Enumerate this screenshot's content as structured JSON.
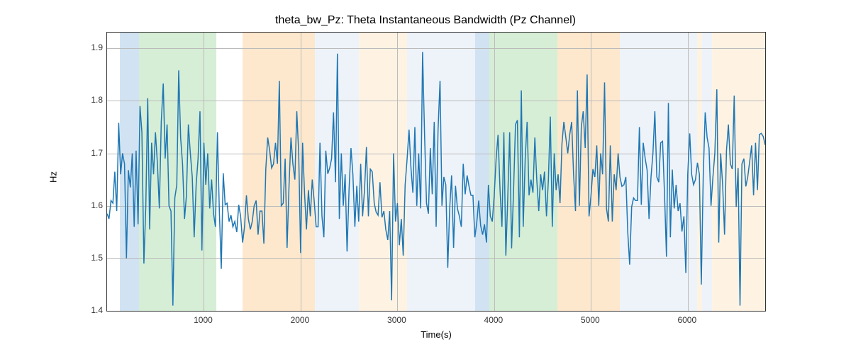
{
  "chart_data": {
    "type": "line",
    "title": "theta_bw_Pz: Theta Instantaneous Bandwidth (Pz Channel)",
    "xlabel": "Time(s)",
    "ylabel": "Hz",
    "xlim": [
      0,
      6800
    ],
    "ylim": [
      1.4,
      1.93
    ],
    "xticks": [
      1000,
      2000,
      3000,
      4000,
      5000,
      6000
    ],
    "yticks": [
      1.4,
      1.5,
      1.6,
      1.7,
      1.8,
      1.9
    ],
    "span_colors": {
      "blue": "#6fa8d6",
      "green": "#7fc97f",
      "orange": "#fdb863",
      "lightblue": "#c6d9ec",
      "lightorange": "#fdd9a8"
    },
    "spans": [
      {
        "start": 130,
        "end": 330,
        "color": "blue"
      },
      {
        "start": 330,
        "end": 1130,
        "color": "green"
      },
      {
        "start": 1400,
        "end": 2150,
        "color": "orange"
      },
      {
        "start": 2150,
        "end": 2600,
        "color": "lightblue"
      },
      {
        "start": 2600,
        "end": 3100,
        "color": "lightorange"
      },
      {
        "start": 3100,
        "end": 3800,
        "color": "lightblue"
      },
      {
        "start": 3800,
        "end": 3950,
        "color": "blue"
      },
      {
        "start": 3950,
        "end": 4650,
        "color": "green"
      },
      {
        "start": 4650,
        "end": 5300,
        "color": "orange"
      },
      {
        "start": 5300,
        "end": 6100,
        "color": "lightblue"
      },
      {
        "start": 6100,
        "end": 6150,
        "color": "lightorange"
      },
      {
        "start": 6150,
        "end": 6250,
        "color": "lightblue"
      },
      {
        "start": 6250,
        "end": 6800,
        "color": "lightorange"
      }
    ],
    "series": [
      {
        "name": "theta_bw_Pz",
        "x": [
          0,
          20,
          40,
          60,
          80,
          100,
          120,
          140,
          160,
          180,
          200,
          220,
          240,
          260,
          280,
          300,
          320,
          340,
          360,
          380,
          400,
          420,
          440,
          460,
          480,
          500,
          520,
          540,
          560,
          580,
          600,
          620,
          640,
          660,
          680,
          700,
          720,
          740,
          760,
          780,
          800,
          820,
          840,
          860,
          880,
          900,
          920,
          940,
          960,
          980,
          1000,
          1020,
          1040,
          1060,
          1080,
          1100,
          1120,
          1140,
          1160,
          1180,
          1200,
          1220,
          1240,
          1260,
          1280,
          1300,
          1320,
          1340,
          1360,
          1380,
          1400,
          1420,
          1440,
          1460,
          1480,
          1500,
          1520,
          1540,
          1560,
          1580,
          1600,
          1620,
          1640,
          1660,
          1680,
          1700,
          1720,
          1740,
          1760,
          1780,
          1800,
          1820,
          1840,
          1860,
          1880,
          1900,
          1920,
          1940,
          1960,
          1980,
          2000,
          2020,
          2040,
          2060,
          2080,
          2100,
          2120,
          2140,
          2160,
          2180,
          2200,
          2220,
          2240,
          2260,
          2280,
          2300,
          2320,
          2340,
          2360,
          2380,
          2400,
          2420,
          2440,
          2460,
          2480,
          2500,
          2520,
          2540,
          2560,
          2580,
          2600,
          2620,
          2640,
          2660,
          2680,
          2700,
          2720,
          2740,
          2760,
          2780,
          2800,
          2820,
          2840,
          2860,
          2880,
          2900,
          2920,
          2940,
          2960,
          2980,
          3000,
          3020,
          3040,
          3060,
          3080,
          3100,
          3120,
          3140,
          3160,
          3180,
          3200,
          3220,
          3240,
          3260,
          3280,
          3300,
          3320,
          3340,
          3360,
          3380,
          3400,
          3420,
          3440,
          3460,
          3480,
          3500,
          3520,
          3540,
          3560,
          3580,
          3600,
          3620,
          3640,
          3660,
          3680,
          3700,
          3720,
          3740,
          3760,
          3780,
          3800,
          3820,
          3840,
          3860,
          3880,
          3900,
          3920,
          3940,
          3960,
          3980,
          4000,
          4020,
          4040,
          4060,
          4080,
          4100,
          4120,
          4140,
          4160,
          4180,
          4200,
          4220,
          4240,
          4260,
          4280,
          4300,
          4320,
          4340,
          4360,
          4380,
          4400,
          4420,
          4440,
          4460,
          4480,
          4500,
          4520,
          4540,
          4560,
          4580,
          4600,
          4620,
          4640,
          4660,
          4680,
          4700,
          4720,
          4740,
          4760,
          4780,
          4800,
          4820,
          4840,
          4860,
          4880,
          4900,
          4920,
          4940,
          4960,
          4980,
          5000,
          5020,
          5040,
          5060,
          5080,
          5100,
          5120,
          5140,
          5160,
          5180,
          5200,
          5220,
          5240,
          5260,
          5280,
          5300,
          5320,
          5340,
          5360,
          5380,
          5400,
          5420,
          5440,
          5460,
          5480,
          5500,
          5520,
          5540,
          5560,
          5580,
          5600,
          5620,
          5640,
          5660,
          5680,
          5700,
          5720,
          5740,
          5760,
          5780,
          5800,
          5820,
          5840,
          5860,
          5880,
          5900,
          5920,
          5940,
          5960,
          5980,
          6000,
          6020,
          6040,
          6060,
          6080,
          6100,
          6120,
          6140,
          6160,
          6180,
          6200,
          6220,
          6240,
          6260,
          6280,
          6300,
          6320,
          6340,
          6360,
          6380,
          6400,
          6420,
          6440,
          6460,
          6480,
          6500,
          6520,
          6540,
          6560,
          6580,
          6600,
          6620,
          6640,
          6660,
          6680,
          6700,
          6720,
          6740,
          6760,
          6780,
          6800
        ],
        "y": [
          1.585,
          1.575,
          1.61,
          1.605,
          1.665,
          1.59,
          1.758,
          1.66,
          1.7,
          1.68,
          1.5,
          1.668,
          1.635,
          1.7,
          1.56,
          1.705,
          1.565,
          1.79,
          1.74,
          1.49,
          1.6,
          1.805,
          1.555,
          1.72,
          1.66,
          1.74,
          1.68,
          1.595,
          1.76,
          1.833,
          1.69,
          1.755,
          1.6,
          1.59,
          1.41,
          1.615,
          1.64,
          1.858,
          1.73,
          1.68,
          1.575,
          1.62,
          1.755,
          1.7,
          1.655,
          1.54,
          1.64,
          1.69,
          1.78,
          1.515,
          1.72,
          1.64,
          1.7,
          1.595,
          1.65,
          1.585,
          1.56,
          1.74,
          1.59,
          1.48,
          1.662,
          1.602,
          1.605,
          1.57,
          1.582,
          1.56,
          1.57,
          1.55,
          1.602,
          1.58,
          1.53,
          1.56,
          1.62,
          1.575,
          1.555,
          1.57,
          1.6,
          1.61,
          1.545,
          1.59,
          1.59,
          1.528,
          1.67,
          1.73,
          1.705,
          1.672,
          1.68,
          1.72,
          1.68,
          1.838,
          1.6,
          1.605,
          1.69,
          1.52,
          1.64,
          1.73,
          1.68,
          1.65,
          1.78,
          1.7,
          1.51,
          1.72,
          1.625,
          1.555,
          1.63,
          1.58,
          1.65,
          1.61,
          1.56,
          1.56,
          1.72,
          1.58,
          1.54,
          1.705,
          1.661,
          1.672,
          1.69,
          1.778,
          1.645,
          1.89,
          1.575,
          1.7,
          1.6,
          1.66,
          1.513,
          1.63,
          1.71,
          1.66,
          1.56,
          1.638,
          1.57,
          1.68,
          1.58,
          1.63,
          1.712,
          1.58,
          1.67,
          1.665,
          1.605,
          1.588,
          1.582,
          1.645,
          1.578,
          1.59,
          1.555,
          1.535,
          1.59,
          1.42,
          1.7,
          1.57,
          1.605,
          1.525,
          1.575,
          1.505,
          1.64,
          1.69,
          1.745,
          1.672,
          1.625,
          1.75,
          1.6,
          1.7,
          1.595,
          1.893,
          1.74,
          1.605,
          1.585,
          1.71,
          1.622,
          1.76,
          1.56,
          1.745,
          1.838,
          1.6,
          1.655,
          1.64,
          1.482,
          1.595,
          1.658,
          1.52,
          1.638,
          1.595,
          1.58,
          1.56,
          1.68,
          1.622,
          1.658,
          1.637,
          1.62,
          1.62,
          1.54,
          1.568,
          1.61,
          1.562,
          1.545,
          1.565,
          1.53,
          1.64,
          1.58,
          1.57,
          1.62,
          1.69,
          1.735,
          1.63,
          1.56,
          1.74,
          1.505,
          1.615,
          1.74,
          1.519,
          1.63,
          1.755,
          1.763,
          1.54,
          1.82,
          1.56,
          1.69,
          1.76,
          1.62,
          1.65,
          1.625,
          1.73,
          1.65,
          1.59,
          1.66,
          1.63,
          1.665,
          1.58,
          1.65,
          1.77,
          1.56,
          1.7,
          1.63,
          1.66,
          1.605,
          1.718,
          1.76,
          1.73,
          1.7,
          1.735,
          1.76,
          1.66,
          1.59,
          1.82,
          1.6,
          1.75,
          1.78,
          1.71,
          1.85,
          1.58,
          1.62,
          1.67,
          1.655,
          1.715,
          1.6,
          1.7,
          1.66,
          1.835,
          1.595,
          1.57,
          1.715,
          1.57,
          1.66,
          1.63,
          1.7,
          1.654,
          1.637,
          1.64,
          1.655,
          1.55,
          1.488,
          1.598,
          1.615,
          1.61,
          1.61,
          1.75,
          1.602,
          1.72,
          1.69,
          1.668,
          1.575,
          1.655,
          1.7,
          1.78,
          1.655,
          1.645,
          1.72,
          1.723,
          1.62,
          1.503,
          1.796,
          1.54,
          1.669,
          1.595,
          1.64,
          1.59,
          1.605,
          1.551,
          1.58,
          1.472,
          1.66,
          1.738,
          1.66,
          1.64,
          1.65,
          1.682,
          1.66,
          1.45,
          1.66,
          1.778,
          1.73,
          1.71,
          1.6,
          1.655,
          1.7,
          1.822,
          1.53,
          1.7,
          1.64,
          1.545,
          1.705,
          1.755,
          1.68,
          1.67,
          1.81,
          1.598,
          1.672,
          1.41,
          1.68,
          1.69,
          1.637,
          1.655,
          1.685,
          1.715,
          1.62,
          1.72,
          1.63,
          1.736,
          1.738,
          1.732,
          1.716
        ]
      }
    ]
  }
}
